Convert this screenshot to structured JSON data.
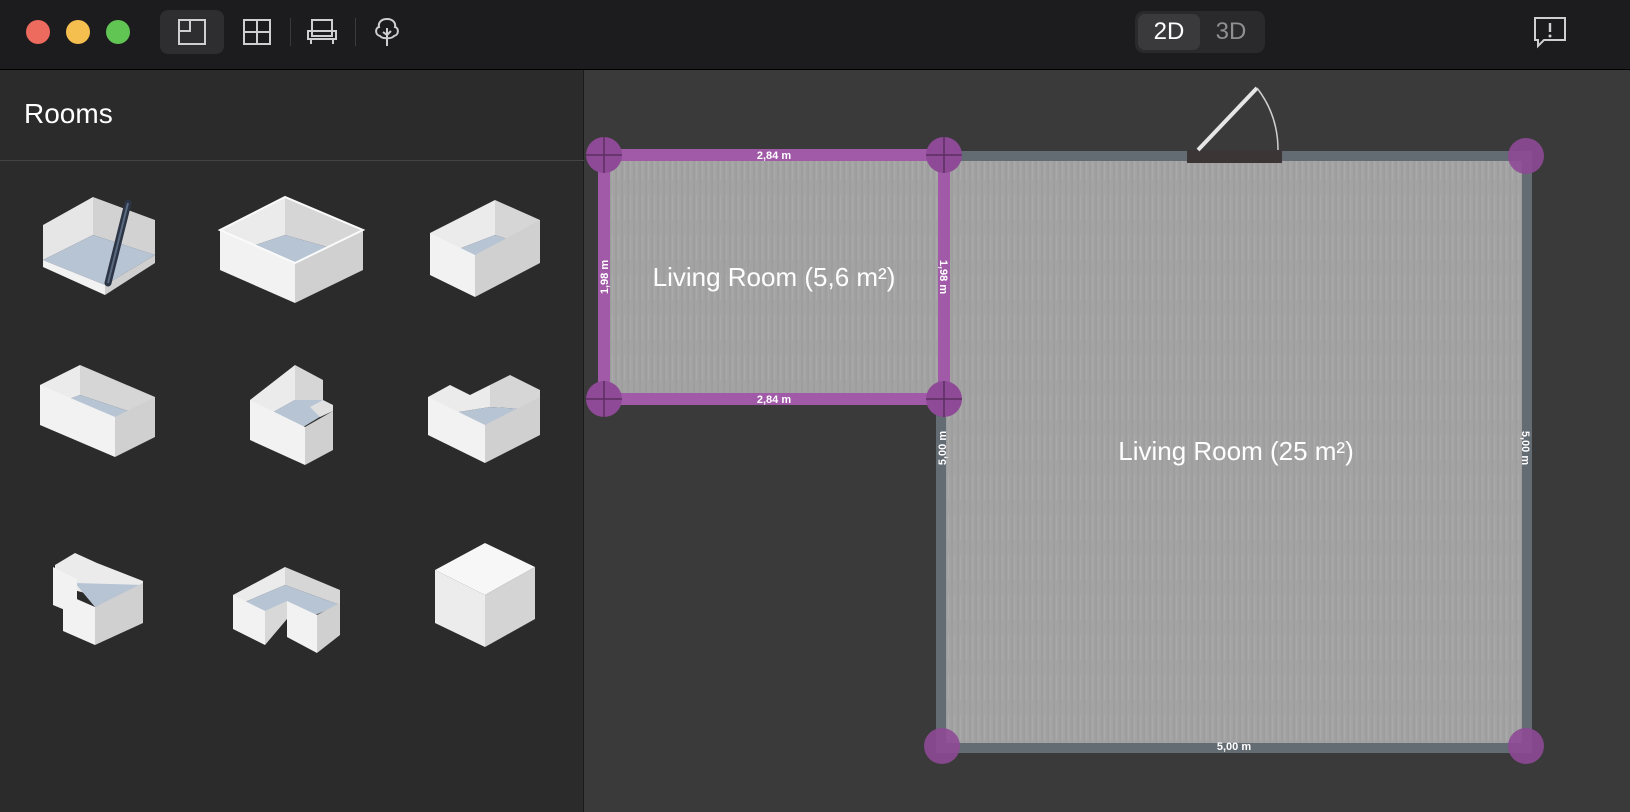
{
  "toolbar": {
    "tools": [
      {
        "icon": "rooms-icon",
        "active": true
      },
      {
        "icon": "windows-doors-icon",
        "active": false
      },
      {
        "icon": "furniture-icon",
        "active": false
      },
      {
        "icon": "landscape-tree-icon",
        "active": false
      }
    ],
    "view_modes": [
      "2D",
      "3D"
    ],
    "active_view": "2D",
    "feedback_icon": "feedback-icon"
  },
  "sidebar": {
    "title": "Rooms",
    "room_templates": [
      {
        "icon": "draw-room-icon"
      },
      {
        "icon": "large-rectangular-room-icon"
      },
      {
        "icon": "small-rectangular-room-icon"
      },
      {
        "icon": "wide-rectangular-room-icon"
      },
      {
        "icon": "notched-room-icon"
      },
      {
        "icon": "l-shaped-room-icon"
      },
      {
        "icon": "z-shaped-room-icon"
      },
      {
        "icon": "t-shaped-room-icon"
      },
      {
        "icon": "solid-block-icon"
      }
    ]
  },
  "plan": {
    "rooms": [
      {
        "label": "Living Room (5,6 m²)",
        "selected": true,
        "dims": {
          "top": "2,84 m",
          "bottom": "2,84 m",
          "left": "1,98 m",
          "right": "1,98 m"
        }
      },
      {
        "label": "Living Room (25 m²)",
        "selected": false,
        "dims": {
          "bottom": "5,00 m",
          "left": "5,00 m",
          "right": "5,00 m"
        }
      }
    ],
    "colors": {
      "selected_wall": "#a05aa8",
      "wall": "#636b73",
      "handle": "#8e4a96",
      "floor": "#a3a3a3"
    }
  }
}
